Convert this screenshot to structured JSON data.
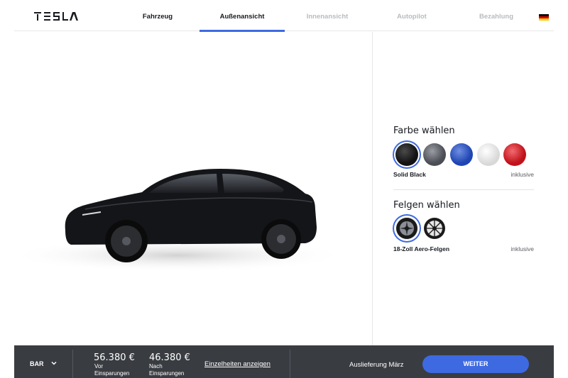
{
  "header": {
    "logo_text": "TESLA",
    "tabs": [
      {
        "label": "Fahrzeug",
        "state": "active"
      },
      {
        "label": "Außenansicht",
        "state": "selected"
      },
      {
        "label": "Innenansicht",
        "state": "disabled"
      },
      {
        "label": "Autopilot",
        "state": "disabled"
      },
      {
        "label": "Bezahlung",
        "state": "disabled"
      }
    ],
    "language_flag": "german-flag-icon"
  },
  "stage": {
    "car_icon": "car-image",
    "car_color": "#111214"
  },
  "color_section": {
    "title": "Farbe wählen",
    "selected_name": "Solid Black",
    "selected_price": "inklusive",
    "swatches": [
      {
        "name": "black-paint",
        "color": "#121212",
        "selected": true
      },
      {
        "name": "grey-paint",
        "color": "#4b4e55",
        "selected": false
      },
      {
        "name": "blue-paint",
        "color": "#1f45b3",
        "selected": false
      },
      {
        "name": "white-paint",
        "color": "#e4e4e4",
        "selected": false
      },
      {
        "name": "red-paint",
        "color": "#c0121a",
        "selected": false
      }
    ]
  },
  "wheel_section": {
    "title": "Felgen wählen",
    "selected_name": "18-Zoll Aero-Felgen",
    "selected_price": "inklusive",
    "wheels": [
      {
        "name": "aero-wheel",
        "selected": true
      },
      {
        "name": "sport-wheel",
        "selected": false
      }
    ]
  },
  "footer": {
    "payment_type": "BAR",
    "price_before": "56.380 €",
    "price_before_label": "Vor Einsparungen",
    "price_after": "46.380 €",
    "price_after_label": "Nach Einsparungen",
    "details_link": "Einzelheiten anzeigen",
    "delivery": "Auslieferung März",
    "next_button": "WEITER"
  },
  "colors": {
    "accent": "#3e6ae1",
    "footer_bg": "#393c41"
  }
}
